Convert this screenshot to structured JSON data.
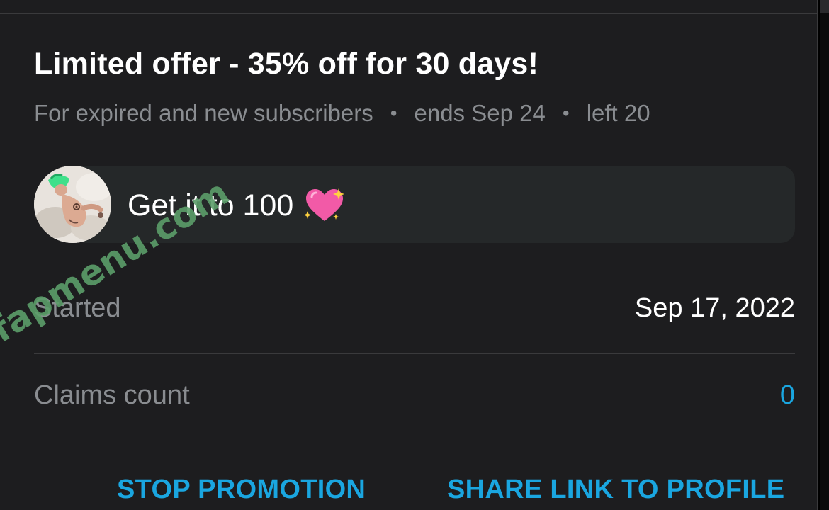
{
  "offer": {
    "title": "Limited offer - 35% off for 30 days!",
    "audience": "For expired and new subscribers",
    "ends": "ends Sep 24",
    "left": "left 20",
    "separator": "•"
  },
  "message": {
    "text": "Get it to 100",
    "emoji_icon": "sparkling-heart-icon"
  },
  "details": {
    "started_label": "Started",
    "started_value": "Sep 17, 2022",
    "claims_label": "Claims count",
    "claims_value": "0"
  },
  "actions": {
    "stop_label": "STOP PROMOTION",
    "share_label": "SHARE LINK TO PROFILE"
  },
  "watermark": "fapmenu.com",
  "colors": {
    "background": "#1d1d1f",
    "accent": "#1aa6e0",
    "muted_text": "#8a8d91",
    "bubble": "#252829"
  }
}
